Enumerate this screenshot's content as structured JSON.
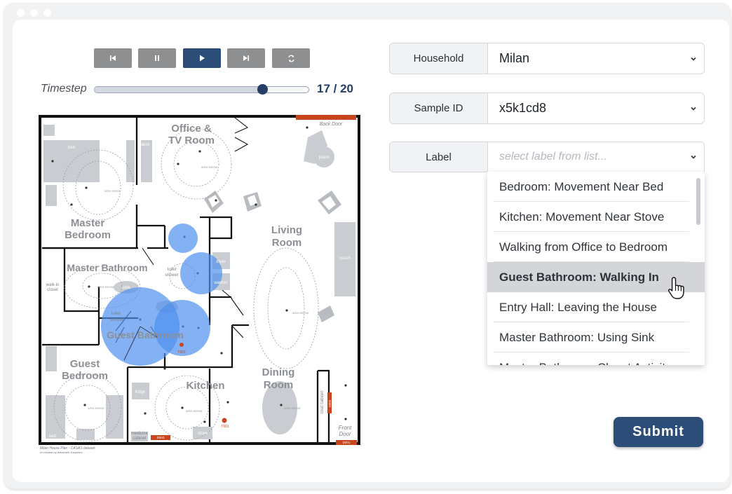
{
  "timeline": {
    "label": "Timestep",
    "current": 17,
    "total": 20,
    "display": "17 / 20",
    "controls": [
      {
        "name": "skip-back",
        "icon": "skip-back-icon",
        "active": false
      },
      {
        "name": "pause",
        "icon": "pause-icon",
        "active": false
      },
      {
        "name": "play",
        "icon": "play-icon",
        "active": true
      },
      {
        "name": "skip-forward",
        "icon": "skip-forward-icon",
        "active": false
      },
      {
        "name": "repeat",
        "icon": "repeat-icon",
        "active": false
      }
    ]
  },
  "floorplan": {
    "rooms": {
      "office_1": "Office &",
      "office_2": "TV Room",
      "master_bed_1": "Master",
      "master_bed_2": "Bedroom",
      "master_bath": "Master Bathroom",
      "living_1": "Living",
      "living_2": "Room",
      "guest_bath": "Guest Bathroom",
      "guest_bed_1": "Guest",
      "guest_bed_2": "Bedroom",
      "kitchen": "Kitchen",
      "dining_1": "Dining",
      "dining_2": "Room"
    },
    "furniture": {
      "bed": "bed",
      "bed2": "bed",
      "desk": "desk",
      "couch": "couch",
      "stove": "stove",
      "fridge": "fridge",
      "medicine_1": "medicine",
      "medicine_2": "cabinet",
      "coat": "coat cabinet",
      "toilet": "toilet",
      "shower": "shower",
      "toilet2": "toilet",
      "shower2": "shower",
      "sink": "sink",
      "walkin_1": "walk-in",
      "walkin_2": "closet",
      "dryer": "dryer",
      "washer": "washer",
      "piano": "piano"
    },
    "doors": {
      "back": "Back Door",
      "front_1": "Front",
      "front_2": "Door",
      "d001": "D001",
      "d002": "D002",
      "d003": "D003",
      "t001": "T001",
      "t002": "T002"
    },
    "area_sensor": "area sensor",
    "caption_1": "Milan House Plan - CASAS dataset",
    "caption_2": "re-created by Alexander Karpekov"
  },
  "form": {
    "household_label": "Household",
    "household_value": "Milan",
    "sample_label": "Sample ID",
    "sample_value": "x5k1cd8",
    "label_label": "Label",
    "label_placeholder": "select label from list...",
    "options": [
      "Bedroom: Movement Near Bed",
      "Kitchen: Movement Near Stove",
      "Walking from Office to Bedroom",
      "Guest Bathroom: Walking In",
      "Entry Hall: Leaving the House",
      "Master Bathroom: Using Sink",
      "Master Bathroom: Closet Activity"
    ],
    "selected_index": 3,
    "submit_label": "Submit"
  },
  "colors": {
    "accent": "#2c4d77",
    "heat": "#4f90ee",
    "door": "#c8461e"
  }
}
